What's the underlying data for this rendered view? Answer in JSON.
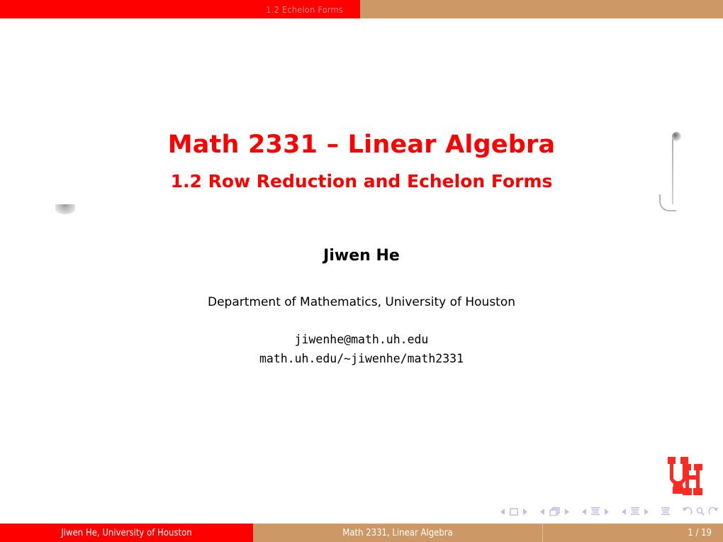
{
  "header": {
    "section_label": "1.2  Echelon Forms",
    "bar_red": "#FF0000",
    "bar_tan": "#CC9966",
    "label_color": "#FF8A80"
  },
  "title": {
    "main": "Math 2331 – Linear Algebra",
    "subtitle": "1.2  Row Reduction and Echelon Forms",
    "color": "#FF0000"
  },
  "author": {
    "name": "Jiwen He",
    "affiliation": "Department of Mathematics, University of Houston",
    "email": "jiwenhe@math.uh.edu",
    "homepage": "math.uh.edu/∼jiwenhe/math2331"
  },
  "logo": {
    "name": "uh-logo",
    "alt": "UH",
    "color": "#FF2A22"
  },
  "navigation": {
    "icon_color": "#BFC0E8",
    "groups": [
      {
        "name": "frame-navigation",
        "prev": "◀",
        "symbol": "frame-icon",
        "next": "▶"
      },
      {
        "name": "subsection-navigation",
        "prev": "◀",
        "symbol": "frames-stack-icon",
        "next": "▶"
      },
      {
        "name": "section-navigation",
        "prev": "◀",
        "symbol": "document-lines-icon",
        "next": "▶"
      },
      {
        "name": "presentation-navigation",
        "prev": "◀",
        "symbol": "document-lines-icon",
        "next": "▶"
      }
    ],
    "doc_symbol": "document-lines-icon",
    "back_symbol": "back-arrow-icon",
    "search_symbol": "magnifier-icon",
    "forward_symbol": "forward-arrow-icon"
  },
  "footer": {
    "author": "Jiwen He, University of Houston",
    "course": "Math 2331, Linear Algebra",
    "page": "1 / 19",
    "red": "#FF0000",
    "tan": "#CC9966",
    "text_color": "#FFFFFF"
  }
}
